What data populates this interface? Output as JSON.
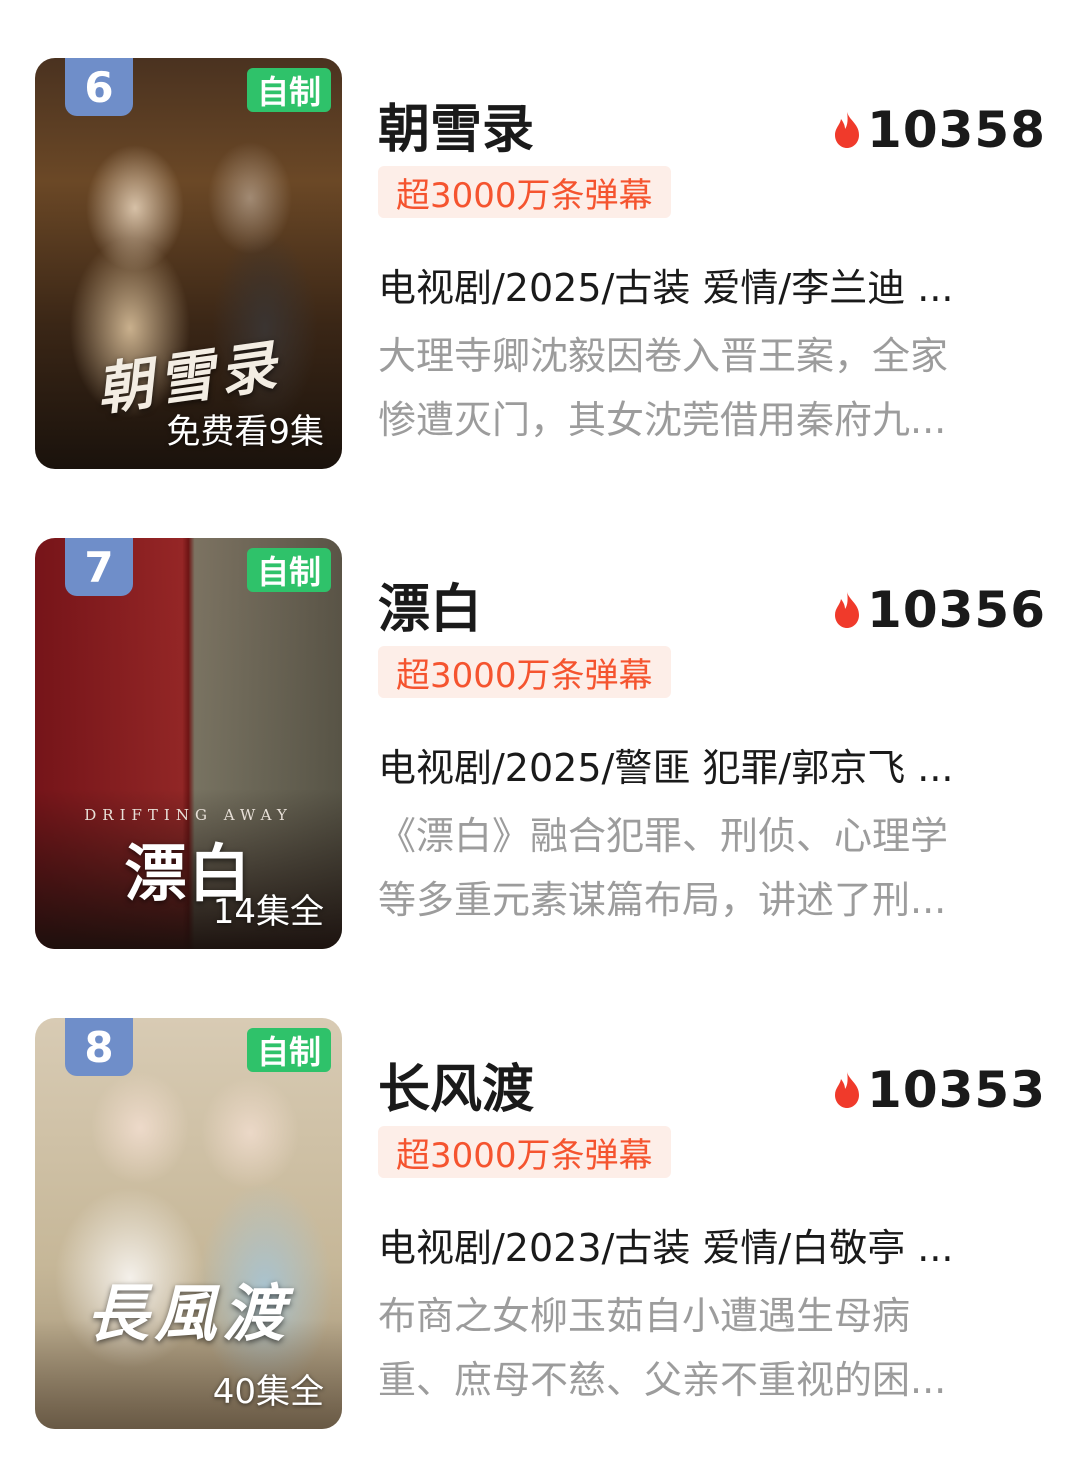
{
  "items": [
    {
      "rank": "6",
      "badge": "自制",
      "poster_text": "朝雪录",
      "poster_subtitle": "",
      "episode_info": "免费看9集",
      "title": "朝雪录",
      "heat": "10358",
      "tag": "超3000万条弹幕",
      "meta": "电视剧/2025/古装 爱情/李兰迪 ...",
      "desc_line1": "大理寺卿沈毅因卷入晋王案，全家",
      "desc_line2": "惨遭灭门，其女沈莞借用秦府九..."
    },
    {
      "rank": "7",
      "badge": "自制",
      "poster_text": "漂白",
      "poster_subtitle": "DRIFTING AWAY",
      "episode_info": "14集全",
      "title": "漂白",
      "heat": "10356",
      "tag": "超3000万条弹幕",
      "meta": "电视剧/2025/警匪 犯罪/郭京飞 ...",
      "desc_line1": "《漂白》融合犯罪、刑侦、心理学",
      "desc_line2": "等多重元素谋篇布局，讲述了刑..."
    },
    {
      "rank": "8",
      "badge": "自制",
      "poster_text": "長風渡",
      "poster_subtitle": "",
      "episode_info": "40集全",
      "title": "长风渡",
      "heat": "10353",
      "tag": "超3000万条弹幕",
      "meta": "电视剧/2023/古装 爱情/白敬亭 ...",
      "desc_line1": "布商之女柳玉茹自小遭遇生母病",
      "desc_line2": "重、庶母不慈、父亲不重视的困..."
    }
  ],
  "colors": {
    "rank_badge": "#6f8ec9",
    "own_badge": "#2fc26a",
    "tag_text": "#f5542f",
    "tag_bg": "#fdeee8",
    "fire_icon": "#f03a2b",
    "desc_text": "#9c9c9c"
  },
  "icons": {
    "heat": "fire-icon"
  }
}
